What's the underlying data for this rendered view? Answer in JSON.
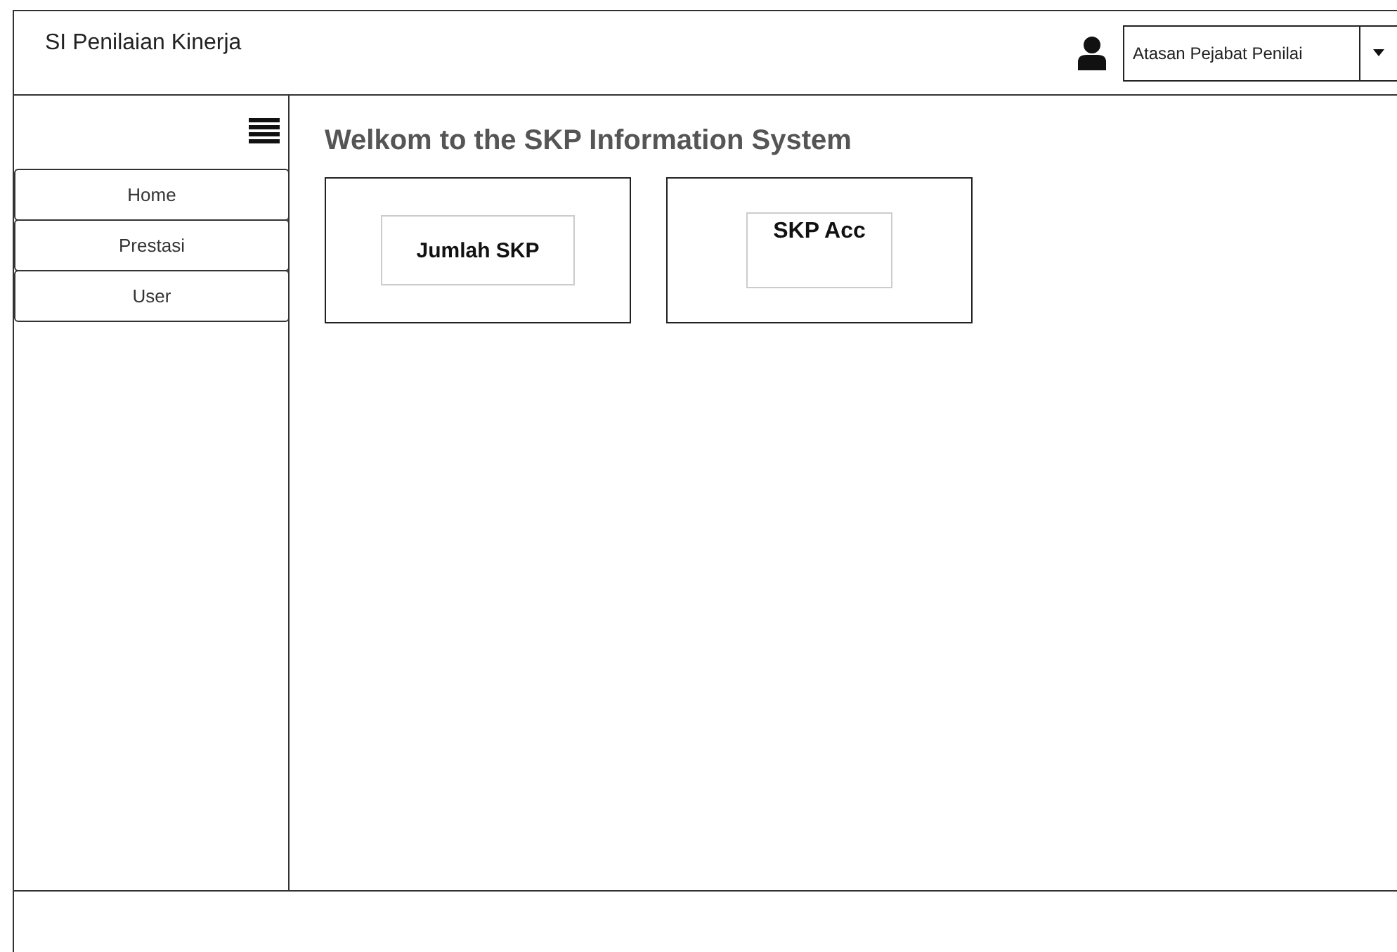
{
  "app_title": "SI Penilaian Kinerja",
  "user_role": {
    "value": "Atasan Pejabat Penilai"
  },
  "menu": [
    {
      "label": "Home"
    },
    {
      "label": "Prestasi"
    },
    {
      "label": "User"
    }
  ],
  "heading": "Welkom to the SKP Information System",
  "cards": [
    {
      "label": "Jumlah SKP",
      "kind": "centered"
    },
    {
      "label": "SKP Acc",
      "kind": "raised"
    }
  ]
}
